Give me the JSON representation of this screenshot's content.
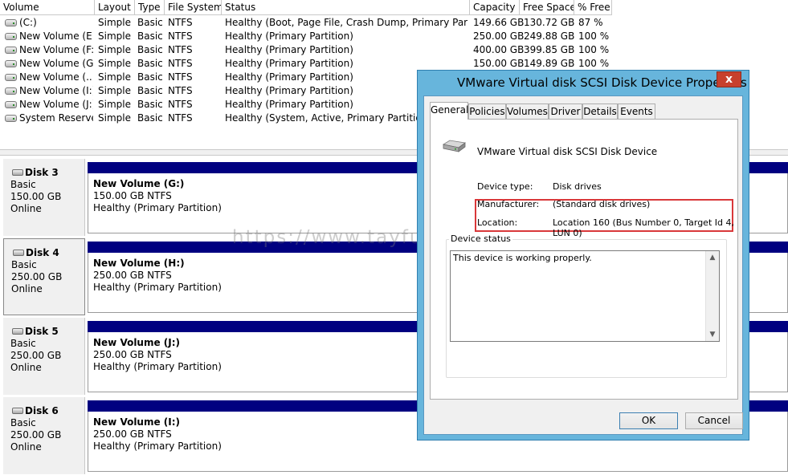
{
  "volume_list": {
    "columns": [
      "Volume",
      "Layout",
      "Type",
      "File System",
      "Status",
      "Capacity",
      "Free Space",
      "% Free"
    ],
    "rows": [
      {
        "volume": "(C:)",
        "layout": "Simple",
        "type": "Basic",
        "fs": "NTFS",
        "status": "Healthy (Boot, Page File, Crash Dump, Primary Partition)",
        "capacity": "149.66 GB",
        "free": "130.72 GB",
        "pct": "87 %"
      },
      {
        "volume": "New Volume (E:)",
        "layout": "Simple",
        "type": "Basic",
        "fs": "NTFS",
        "status": "Healthy (Primary Partition)",
        "capacity": "250.00 GB",
        "free": "249.88 GB",
        "pct": "100 %"
      },
      {
        "volume": "New Volume (F:)",
        "layout": "Simple",
        "type": "Basic",
        "fs": "NTFS",
        "status": "Healthy (Primary Partition)",
        "capacity": "400.00 GB",
        "free": "399.85 GB",
        "pct": "100 %"
      },
      {
        "volume": "New Volume (G:)",
        "layout": "Simple",
        "type": "Basic",
        "fs": "NTFS",
        "status": "Healthy (Primary Partition)",
        "capacity": "150.00 GB",
        "free": "149.89 GB",
        "pct": "100 %"
      },
      {
        "volume": "New Volume (...",
        "layout": "Simple",
        "type": "Basic",
        "fs": "NTFS",
        "status": "Healthy (Primary Partition)",
        "capacity": "",
        "free": "",
        "pct": ""
      },
      {
        "volume": "New Volume (I:)",
        "layout": "Simple",
        "type": "Basic",
        "fs": "NTFS",
        "status": "Healthy (Primary Partition)",
        "capacity": "",
        "free": "",
        "pct": ""
      },
      {
        "volume": "New Volume (J:)",
        "layout": "Simple",
        "type": "Basic",
        "fs": "NTFS",
        "status": "Healthy (Primary Partition)",
        "capacity": "",
        "free": "",
        "pct": ""
      },
      {
        "volume": "System Reserved",
        "layout": "Simple",
        "type": "Basic",
        "fs": "NTFS",
        "status": "Healthy (System, Active, Primary Partition)",
        "capacity": "",
        "free": "",
        "pct": ""
      }
    ]
  },
  "disks": [
    {
      "name": "Disk 3",
      "type": "Basic",
      "size": "150.00 GB",
      "state": "Online",
      "partition": {
        "name": "New Volume  (G:)",
        "size": "150.00 GB NTFS",
        "status": "Healthy (Primary Partition)"
      }
    },
    {
      "name": "Disk 4",
      "type": "Basic",
      "size": "250.00 GB",
      "state": "Online",
      "partition": {
        "name": "New Volume  (H:)",
        "size": "250.00 GB NTFS",
        "status": "Healthy (Primary Partition)"
      }
    },
    {
      "name": "Disk 5",
      "type": "Basic",
      "size": "250.00 GB",
      "state": "Online",
      "partition": {
        "name": "New Volume  (J:)",
        "size": "250.00 GB NTFS",
        "status": "Healthy (Primary Partition)"
      }
    },
    {
      "name": "Disk 6",
      "type": "Basic",
      "size": "250.00 GB",
      "state": "Online",
      "partition": {
        "name": "New Volume  (I:)",
        "size": "250.00 GB NTFS",
        "status": "Healthy (Primary Partition)"
      }
    }
  ],
  "watermark": "https://www.tayfundeger.com",
  "dialog": {
    "title": "VMware Virtual disk SCSI Disk Device Properties",
    "close_label": "x",
    "tabs": [
      "General",
      "Policies",
      "Volumes",
      "Driver",
      "Details",
      "Events"
    ],
    "device_name": "VMware Virtual disk SCSI Disk Device",
    "device_type_label": "Device type:",
    "device_type_value": "Disk drives",
    "manufacturer_label": "Manufacturer:",
    "manufacturer_value": "(Standard disk drives)",
    "location_label": "Location:",
    "location_value_line1": "Location 160 (Bus Number 0, Target Id 4,",
    "location_value_line2": "LUN 0)",
    "status_legend": "Device status",
    "status_text": "This device is working properly.",
    "ok_label": "OK",
    "cancel_label": "Cancel"
  },
  "colors": {
    "dialog_frame": "#67b5dc",
    "close_button": "#c7402d",
    "partition_bar": "#000080",
    "highlight": "#d9383a"
  }
}
